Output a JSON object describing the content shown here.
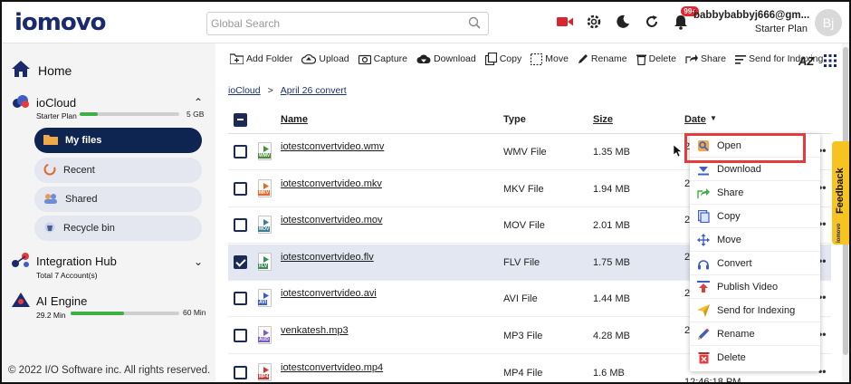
{
  "header": {
    "logo": "iomovo",
    "search_placeholder": "Global Search",
    "notification_badge": "99+",
    "user_email": "babbybabbyj666@gm...",
    "user_plan": "Starter Plan",
    "avatar_initials": "Bj"
  },
  "sidebar": {
    "home": "Home",
    "iocloud": {
      "title": "ioCloud",
      "plan": "Starter Plan",
      "storage": "5 GB",
      "usage_fraction": 0.18
    },
    "subnav": {
      "my_files": "My files",
      "recent": "Recent",
      "shared": "Shared",
      "recycle": "Recycle bin"
    },
    "integration": {
      "title": "Integration Hub",
      "sub": "Total 7 Account(s)"
    },
    "ai": {
      "title": "AI Engine",
      "used": "29.2 Min",
      "total": "60 Min",
      "usage_fraction": 0.49
    },
    "copyright": "© 2022 I/O Software inc. All rights reserved."
  },
  "toolbar": {
    "add_folder": "Add Folder",
    "upload": "Upload",
    "capture": "Capture",
    "download": "Download",
    "copy": "Copy",
    "move": "Move",
    "rename": "Rename",
    "delete": "Delete",
    "share": "Share",
    "send_indexing": "Send for Indexing",
    "sort": "AZ"
  },
  "breadcrumb": {
    "root": "ioCloud",
    "sep": ">",
    "current": "April 26 convert"
  },
  "table": {
    "headers": {
      "name": "Name",
      "type": "Type",
      "size": "Size",
      "date": "Date"
    },
    "rows": [
      {
        "name": "iotestconvertvideo.wmv",
        "type": "WMV File",
        "size": "1.35 MB",
        "tag": "WMV",
        "date": "2",
        "checked": false
      },
      {
        "name": "iotestconvertvideo.mkv",
        "type": "MKV File",
        "size": "1.94 MB",
        "tag": "MKV",
        "date": "2",
        "checked": false
      },
      {
        "name": "iotestconvertvideo.mov",
        "type": "MOV File",
        "size": "2.01 MB",
        "tag": "MOV",
        "date": "2",
        "checked": false
      },
      {
        "name": "iotestconvertvideo.flv",
        "type": "FLV File",
        "size": "1.75 MB",
        "tag": "FLV",
        "date": "2",
        "checked": true
      },
      {
        "name": "iotestconvertvideo.avi",
        "type": "AVI File",
        "size": "1.44 MB",
        "tag": "AVI",
        "date": "2",
        "checked": false
      },
      {
        "name": "venkatesh.mp3",
        "type": "MP3 File",
        "size": "4.28 MB",
        "tag": "AUD",
        "date": "2",
        "checked": false
      },
      {
        "name": "iotestconvertvideo.mp4",
        "type": "MP4 File",
        "size": "1.6 MB",
        "tag": "MP4",
        "date": "12:46:18 PM",
        "checked": false
      }
    ]
  },
  "context_menu": {
    "open": "Open",
    "download": "Download",
    "share": "Share",
    "copy": "Copy",
    "move": "Move",
    "convert": "Convert",
    "publish": "Publish Video",
    "send_indexing": "Send for Indexing",
    "rename": "Rename",
    "delete": "Delete"
  },
  "feedback": "Feedback",
  "feedback_brand": "iomovo",
  "colors": {
    "navy": "#0e2552",
    "accent_red": "#e43c3c",
    "feedback_yellow": "#f6c321",
    "progress_green": "#3cb043"
  }
}
